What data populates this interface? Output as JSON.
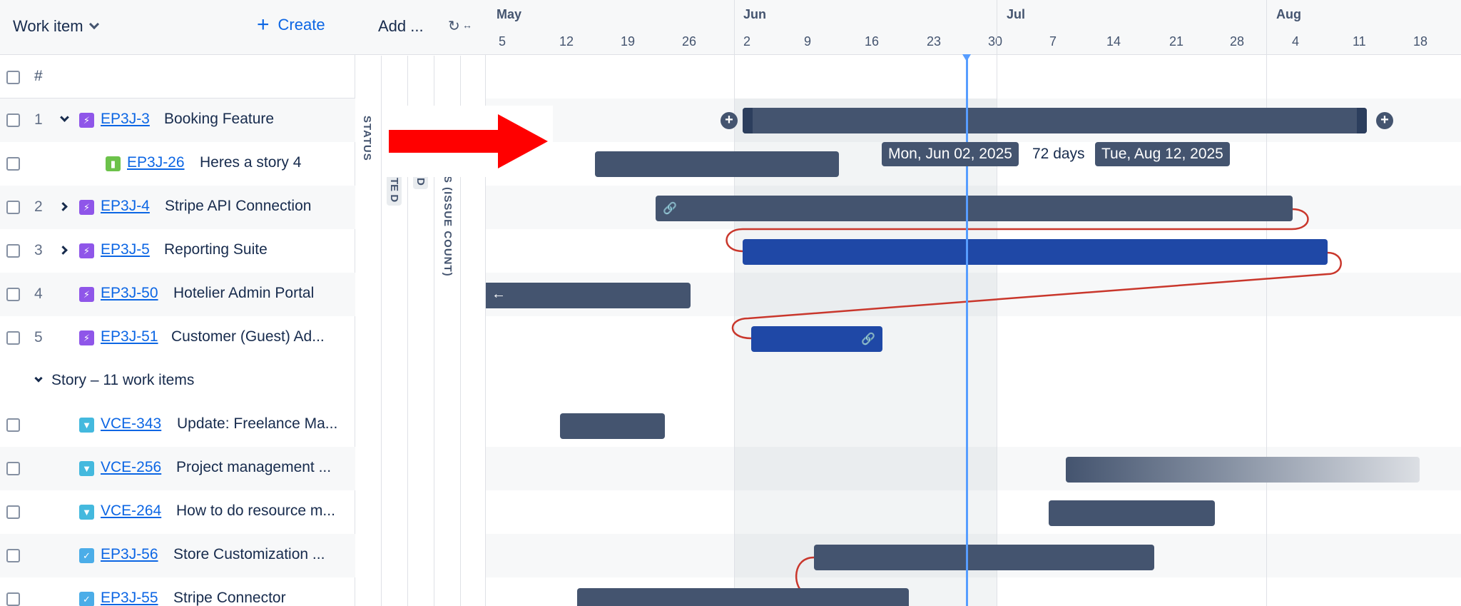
{
  "left_panel": {
    "header": {
      "dropdown_label": "Work item",
      "create_label": "Create"
    },
    "column_header": {
      "key_label": "#"
    },
    "rows": [
      {
        "num": "1",
        "key": "EP3J-3",
        "title": "Booking Feature",
        "icon": "epic-icon",
        "expander": "expanded"
      },
      {
        "num": "",
        "key": "EP3J-26",
        "title": "Heres a story 4",
        "icon": "story-icon",
        "expander": "none"
      },
      {
        "num": "2",
        "key": "EP3J-4",
        "title": "Stripe API Connection",
        "icon": "epic-icon",
        "expander": "collapsed"
      },
      {
        "num": "3",
        "key": "EP3J-5",
        "title": "Reporting Suite",
        "icon": "epic-icon",
        "expander": "collapsed"
      },
      {
        "num": "4",
        "key": "EP3J-50",
        "title": "Hotelier Admin Portal",
        "icon": "epic-icon",
        "expander": "none"
      },
      {
        "num": "5",
        "key": "EP3J-51",
        "title": "Customer (Guest) Ad...",
        "icon": "epic-icon",
        "expander": "none"
      },
      {
        "group_label": "Story – 11 work items"
      },
      {
        "num": "",
        "key": "VCE-343",
        "title": "Update: Freelance Ma...",
        "icon": "feature-icon"
      },
      {
        "num": "",
        "key": "VCE-256",
        "title": "Project management ...",
        "icon": "feature-icon"
      },
      {
        "num": "",
        "key": "VCE-264",
        "title": "How to do resource m...",
        "icon": "feature-icon"
      },
      {
        "num": "",
        "key": "EP3J-56",
        "title": "Store Customization ...",
        "icon": "task-icon"
      },
      {
        "num": "",
        "key": "EP3J-55",
        "title": "Stripe Connector",
        "icon": "task-icon"
      }
    ]
  },
  "fields_panel": {
    "add_label": "Add ...",
    "columns": [
      {
        "label": "STATUS"
      },
      {
        "label": "TE D"
      },
      {
        "label": "D"
      },
      {
        "label": "S (ISSUE COUNT)"
      }
    ]
  },
  "timeline": {
    "months": [
      "May",
      "Jun",
      "Jul",
      "Aug"
    ],
    "weeks": [
      "5",
      "12",
      "19",
      "26",
      "2",
      "9",
      "16",
      "23",
      "30",
      "7",
      "14",
      "21",
      "28",
      "4",
      "11",
      "18"
    ],
    "tooltip": {
      "start": "Mon, Jun 02, 2025",
      "duration": "72 days",
      "end": "Tue, Aug 12, 2025"
    },
    "colors": {
      "bar": "#44546f",
      "bar_selected": "#1f48a6",
      "today": "#579dff",
      "dependency": "#c9372c",
      "callout_arrow": "#ff0000"
    }
  }
}
